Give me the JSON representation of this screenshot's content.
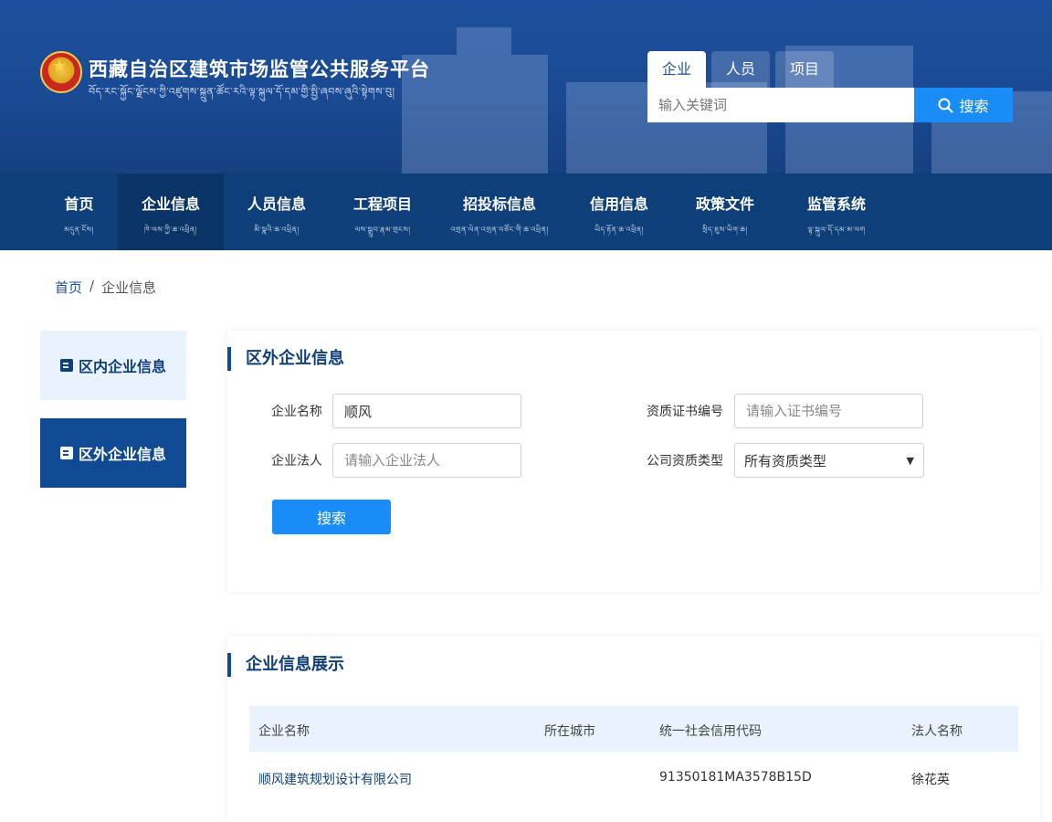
{
  "header": {
    "title": "西藏自治区建筑市场监管公共服务平台",
    "subtitle_tibetan": "བོད་རང་སྐྱོང་ལྗོངས་ཀྱི་འཛུགས་སྐྲུན་ཚོང་རའི་ལྟ་སྐུལ་དོ་དམ་གྱི་སྤྱི་ཞབས་ཞུའི་སྟེགས་བུ།",
    "search_tabs": [
      "企业",
      "人员",
      "项目"
    ],
    "active_search_tab": "企业",
    "search_placeholder": "输入关键词",
    "search_button": "搜索"
  },
  "nav": {
    "items": [
      {
        "label": "首页",
        "sub": "མདུན་ངོས།"
      },
      {
        "label": "企业信息",
        "sub": "ཁེ་ལས་ཀྱི་ཆ་འཕྲིན།"
      },
      {
        "label": "人员信息",
        "sub": "མི་སྣའི་ཆ་འཕྲིན།"
      },
      {
        "label": "工程项目",
        "sub": "ལས་སྒྲུབ་རྣམ་གྲངས།"
      },
      {
        "label": "招投标信息",
        "sub": "འགྲན་ལེན་འགྲན་བཙོང་གི་ཆ་འཕྲིན།"
      },
      {
        "label": "信用信息",
        "sub": "ཡིད་རྟོན་ཆ་འཕྲིན།"
      },
      {
        "label": "政策文件",
        "sub": "སྲིད་ཇུས་ཡིག་ཆ།"
      },
      {
        "label": "监管系统",
        "sub": "ལྟ་སྐུལ་དོ་དམ་མ་ལག"
      }
    ],
    "active": "企业信息"
  },
  "breadcrumb": {
    "home": "首页",
    "sep": "/",
    "current": "企业信息"
  },
  "sidebar": {
    "items": [
      {
        "label": "区内企业信息"
      },
      {
        "label": "区外企业信息"
      }
    ],
    "active": "区外企业信息"
  },
  "search_panel": {
    "title": "区外企业信息",
    "company_name_label": "企业名称",
    "company_name_value": "顺风",
    "cert_no_label": "资质证书编号",
    "cert_no_placeholder": "请输入证书编号",
    "legal_person_label": "企业法人",
    "legal_person_placeholder": "请输入企业法人",
    "qual_type_label": "公司资质类型",
    "qual_type_selected": "所有资质类型",
    "search_button": "搜索"
  },
  "results": {
    "title": "企业信息展示",
    "columns": [
      "企业名称",
      "所在城市",
      "统一社会信用代码",
      "法人名称"
    ],
    "rows": [
      {
        "name": "顺风建筑规划设计有限公司",
        "city": "",
        "credit_code": "91350181MA3578B15D",
        "legal": "徐花英"
      }
    ]
  },
  "colors": {
    "primary": "#0f4a93",
    "nav_bg": "#0f3f78",
    "button": "#1a8cf7",
    "light_bg": "#eaf3fd"
  },
  "icons": [
    "national-emblem-icon",
    "search-icon",
    "document-icon",
    "chevron-down-icon"
  ]
}
